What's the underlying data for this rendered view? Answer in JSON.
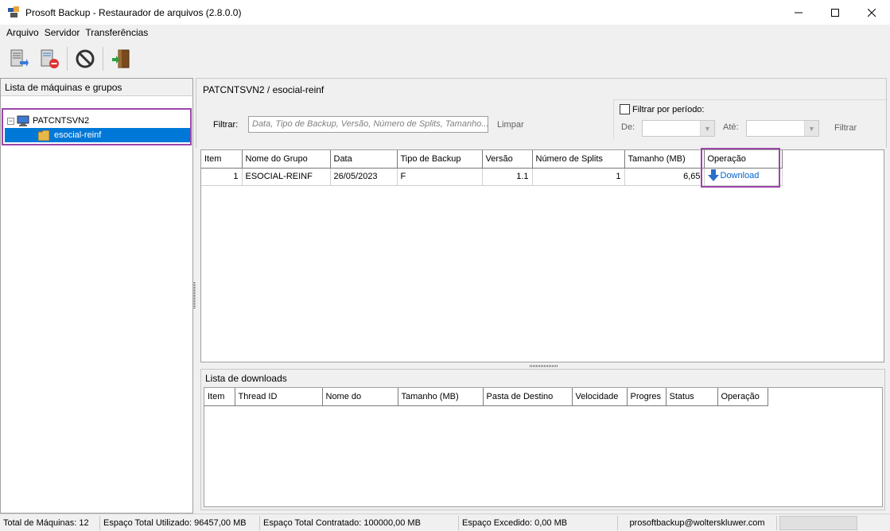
{
  "window": {
    "title": "Prosoft Backup - Restaurador de arquivos (2.8.0.0)",
    "minimize": "—",
    "maximize": "☐",
    "close": "✕"
  },
  "menu": {
    "items": [
      "Arquivo",
      "Servidor",
      "Transferências"
    ]
  },
  "toolbar": {
    "icons": [
      "server-connect-icon",
      "server-remove-icon",
      "stop-icon",
      "exit-door-icon"
    ]
  },
  "left_panel": {
    "header": "Lista de máquinas e grupos",
    "tree": {
      "root": {
        "label": "PATCNTSVN2",
        "expander": "−"
      },
      "child": {
        "label": "esocial-reinf"
      }
    }
  },
  "right_panel": {
    "breadcrumb": "PATCNTSVN2 / esocial-reinf",
    "filter": {
      "label": "Filtrar:",
      "placeholder": "Data, Tipo de Backup, Versão, Número de Splits, Tamanho...",
      "clear": "Limpar",
      "period_label": "Filtrar por período:",
      "from_label": "De:",
      "to_label": "Até:",
      "apply": "Filtrar"
    },
    "grid": {
      "columns": [
        "Item",
        "Nome do Grupo",
        "Data",
        "Tipo de Backup",
        "Versão",
        "Número de Splits",
        "Tamanho (MB)",
        "Operação"
      ],
      "rows": [
        {
          "item": "1",
          "group": "ESOCIAL-REINF",
          "date": "26/05/2023",
          "type": "F",
          "version": "1.1",
          "splits": "1",
          "size": "6,65",
          "operation": "Download"
        }
      ]
    },
    "downloads": {
      "header": "Lista de downloads",
      "columns": [
        "Item",
        "Thread ID",
        "Nome do",
        "Tamanho (MB)",
        "Pasta de Destino",
        "Velocidade",
        "Progres",
        "Status",
        "Operação"
      ]
    }
  },
  "statusbar": {
    "machines": "Total de Máquinas: 12",
    "used": "Espaço Total Utilizado: 96457,00 MB",
    "contracted": "Espaço Total Contratado: 100000,00 MB",
    "exceeded": "Espaço Excedido: 0,00 MB",
    "email": "prosoftbackup@wolterskluwer.com"
  },
  "colors": {
    "selection": "#0078d7",
    "highlight_border": "#9b46a8",
    "link": "#0066cc"
  }
}
